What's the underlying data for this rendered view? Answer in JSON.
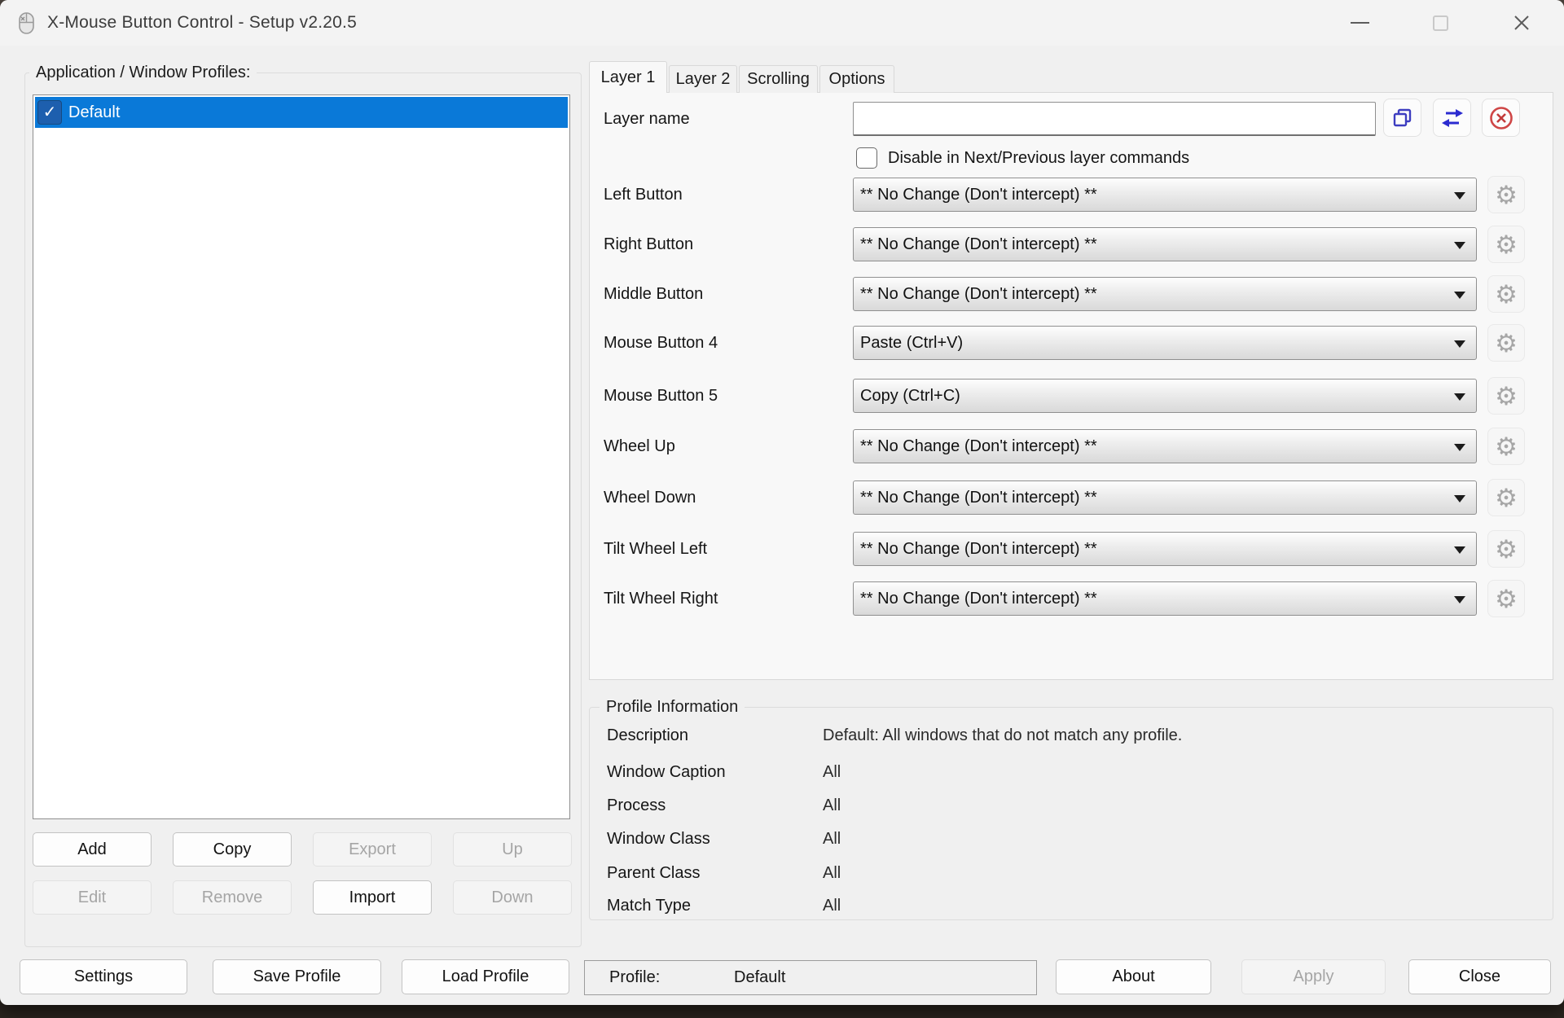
{
  "window": {
    "title": "X-Mouse Button Control - Setup v2.20.5"
  },
  "glyphs": {
    "check": "✓",
    "gear": "⚙"
  },
  "colors": {
    "selection_blue": "#0a79d8",
    "list_checkbox_blue": "#1d5fae",
    "icon_blue": "#3d3dc0",
    "cancel_red": "#cf4646",
    "window_bg": "#f0f0f0",
    "panel_bg": "#f8f8f8"
  },
  "profiles_panel": {
    "label": "Application / Window Profiles:",
    "items": [
      {
        "label": "Default",
        "checked": true,
        "selected": true
      }
    ],
    "buttons": [
      {
        "label": "Add",
        "enabled": true
      },
      {
        "label": "Copy",
        "enabled": true
      },
      {
        "label": "Export",
        "enabled": false
      },
      {
        "label": "Up",
        "enabled": false
      },
      {
        "label": "Edit",
        "enabled": false
      },
      {
        "label": "Remove",
        "enabled": false
      },
      {
        "label": "Import",
        "enabled": true
      },
      {
        "label": "Down",
        "enabled": false
      }
    ]
  },
  "tabs": [
    {
      "label": "Layer 1",
      "active": true
    },
    {
      "label": "Layer 2",
      "active": false
    },
    {
      "label": "Scrolling",
      "active": false
    },
    {
      "label": "Options",
      "active": false
    }
  ],
  "layer_panel": {
    "layer_name_label": "Layer name",
    "layer_name_value": "",
    "disable_label": "Disable in Next/Previous layer commands",
    "disable_checked": false,
    "rows": [
      {
        "label": "Left Button",
        "value": "** No Change (Don't intercept) **"
      },
      {
        "label": "Right Button",
        "value": "** No Change (Don't intercept) **"
      },
      {
        "label": "Middle Button",
        "value": "** No Change (Don't intercept) **"
      },
      {
        "label": "Mouse Button 4",
        "value": "Paste (Ctrl+V)"
      },
      {
        "label": "Mouse Button 5",
        "value": "Copy (Ctrl+C)"
      },
      {
        "label": "Wheel Up",
        "value": "** No Change (Don't intercept) **"
      },
      {
        "label": "Wheel Down",
        "value": "** No Change (Don't intercept) **"
      },
      {
        "label": "Tilt Wheel Left",
        "value": "** No Change (Don't intercept) **"
      },
      {
        "label": "Tilt Wheel Right",
        "value": "** No Change (Don't intercept) **"
      }
    ]
  },
  "profile_info": {
    "title": "Profile Information",
    "rows": [
      {
        "label": "Description",
        "value": "Default: All windows that do not match any profile."
      },
      {
        "label": "Window Caption",
        "value": "All"
      },
      {
        "label": "Process",
        "value": "All"
      },
      {
        "label": "Window Class",
        "value": "All"
      },
      {
        "label": "Parent Class",
        "value": "All"
      },
      {
        "label": "Match Type",
        "value": "All"
      }
    ]
  },
  "bottom_bar": {
    "settings": "Settings",
    "save_profile": "Save Profile",
    "load_profile": "Load Profile",
    "profile_label": "Profile:",
    "profile_value": "Default",
    "about": "About",
    "apply": "Apply",
    "close": "Close"
  }
}
